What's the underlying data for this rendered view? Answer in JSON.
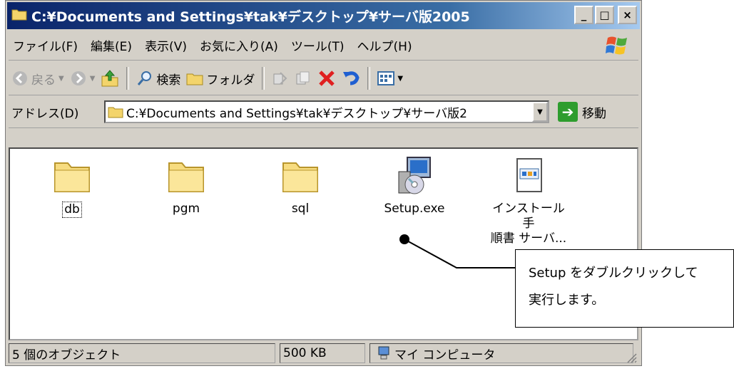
{
  "window": {
    "title": "C:¥Documents and Settings¥tak¥デスクトップ¥サーバ版2005",
    "buttons": {
      "minimize": "_",
      "maximize": "□",
      "close": "×"
    }
  },
  "menu": [
    "ファイル(F)",
    "編集(E)",
    "表示(V)",
    "お気に入り(A)",
    "ツール(T)",
    "ヘルプ(H)"
  ],
  "toolbar": {
    "back_label": "戻る",
    "search_label": "検索",
    "folders_label": "フォルダ"
  },
  "address": {
    "label": "アドレス(D)",
    "value": "C:¥Documents and Settings¥tak¥デスクトップ¥サーバ版2",
    "go_label": "移動"
  },
  "files": [
    {
      "name": "db",
      "icon": "folder-icon"
    },
    {
      "name": "pgm",
      "icon": "folder-icon"
    },
    {
      "name": "sql",
      "icon": "folder-icon"
    },
    {
      "name": "Setup.exe",
      "icon": "setup-installer-icon"
    },
    {
      "name": "インストール手",
      "name2": "順書 サーバ...",
      "icon": "document-icon"
    }
  ],
  "status": {
    "objects": "5 個のオブジェクト",
    "size": "500 KB",
    "location": "マイ コンピュータ"
  },
  "callout": {
    "line1": "Setup をダブルクリックして",
    "line2": "実行します。"
  }
}
